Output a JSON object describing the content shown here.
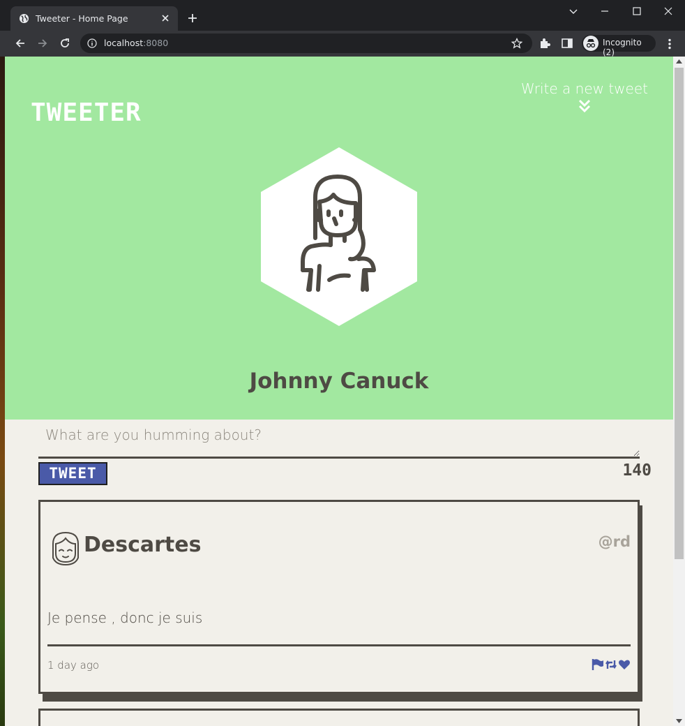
{
  "browser": {
    "tab_title": "Tweeter - Home Page",
    "url_host": "localhost",
    "url_port": ":8080",
    "incognito_label": "Incognito (2)"
  },
  "header": {
    "brand": "TWEETER",
    "write_new_label": "Write a new tweet",
    "profile_name": "Johnny Canuck",
    "bg_color": "#a2e8a0"
  },
  "compose": {
    "placeholder": "What are you humming about?",
    "value": "",
    "tweet_button_label": "TWEET",
    "char_counter": "140"
  },
  "tweets": [
    {
      "name": "Descartes",
      "handle": "@rd",
      "text": "Je pense , donc je suis",
      "time": "1 day ago",
      "actions": [
        "flag-icon",
        "retweet-icon",
        "heart-icon"
      ]
    }
  ],
  "colors": {
    "accent": "#4a5aa8",
    "text": "#4e4a44",
    "background": "#f2f0ea"
  }
}
